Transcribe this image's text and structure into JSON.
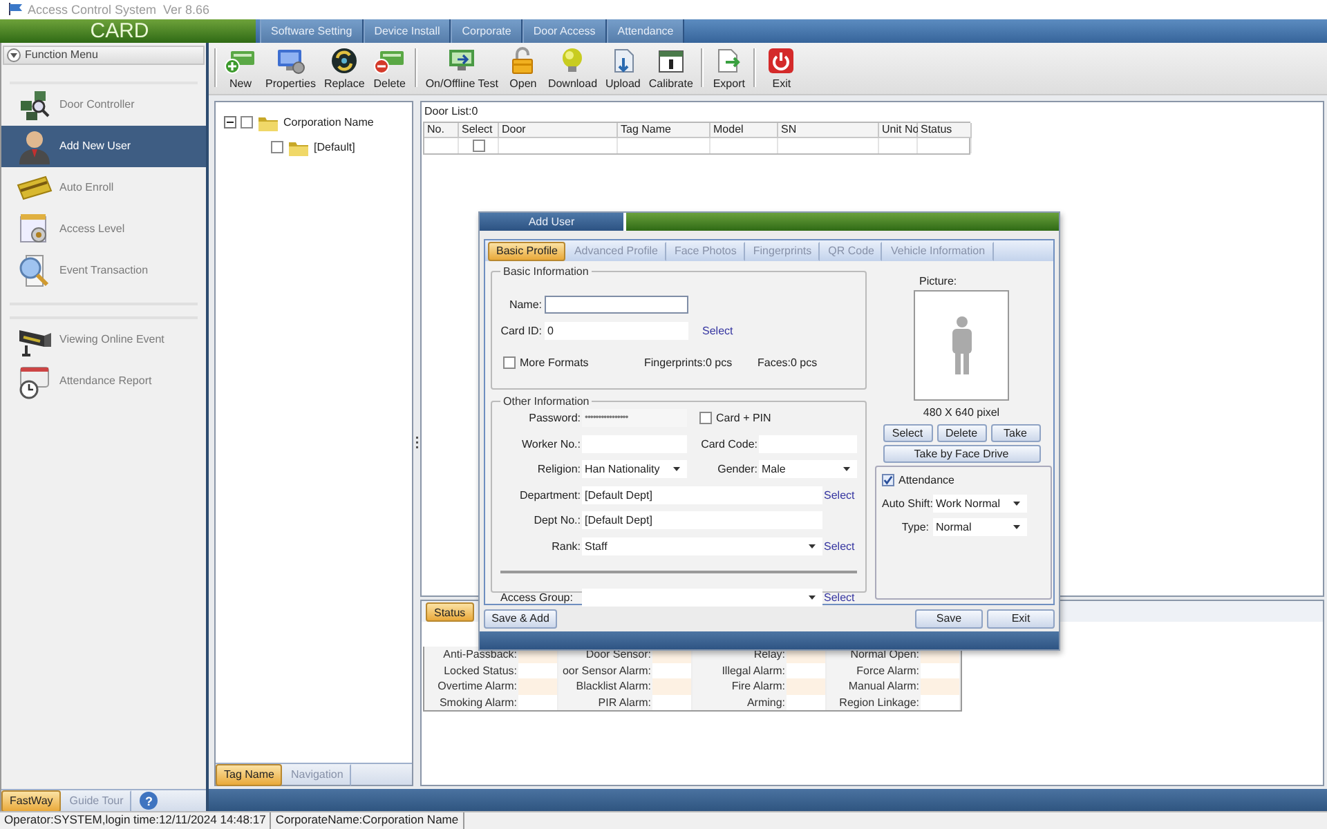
{
  "window": {
    "title": "Access Control System  Ver 8.66"
  },
  "header": {
    "logo": "CARD",
    "menu": [
      "Software Setting",
      "Device Install",
      "Corporate",
      "Door Access",
      "Attendance"
    ]
  },
  "sidebar": {
    "title": "Function Menu",
    "groups": [
      [
        {
          "label": "Door Controller",
          "selected": false
        },
        {
          "label": "Add New User",
          "selected": true
        },
        {
          "label": "Auto Enroll",
          "selected": false
        },
        {
          "label": "Access Level",
          "selected": false
        },
        {
          "label": "Event Transaction",
          "selected": false
        }
      ],
      [
        {
          "label": "Viewing Online Event",
          "selected": false
        },
        {
          "label": "Attendance Report",
          "selected": false
        }
      ]
    ],
    "tabs": [
      {
        "label": "FastWay",
        "selected": true
      },
      {
        "label": "Guide Tour",
        "selected": false
      }
    ],
    "help": "?"
  },
  "toolbar": [
    [
      "New",
      "Properties",
      "Replace",
      "Delete"
    ],
    [
      "On/Offline Test",
      "Open",
      "Download",
      "Upload",
      "Calibrate"
    ],
    [
      "Export"
    ],
    [
      "Exit"
    ]
  ],
  "tree": {
    "nodes": [
      {
        "label": "Corporation Name",
        "expanded": true,
        "checked": false,
        "children": [
          {
            "label": "[Default]",
            "checked": false
          }
        ]
      }
    ],
    "tabs": [
      {
        "label": "Tag Name",
        "selected": true
      },
      {
        "label": "Navigation",
        "selected": false
      }
    ]
  },
  "door_list": {
    "title": "Door List:0",
    "columns": [
      "No.",
      "Select",
      "Door",
      "Tag Name",
      "Model",
      "SN",
      "Unit No",
      "Status"
    ],
    "rows": [
      {
        "checked": false
      }
    ]
  },
  "status_panel": {
    "tabs": [
      {
        "label": "Status",
        "selected": true
      }
    ],
    "rows": [
      [
        "Anti-Passback:",
        "Door Sensor:",
        "Relay:",
        "Normal Open:"
      ],
      [
        "Locked Status:",
        "oor Sensor Alarm:",
        "Illegal Alarm:",
        "Force Alarm:"
      ],
      [
        "Overtime Alarm:",
        "Blacklist Alarm:",
        "Fire Alarm:",
        "Manual Alarm:"
      ],
      [
        "Smoking Alarm:",
        "PIR Alarm:",
        "Arming:",
        "Region Linkage:"
      ]
    ]
  },
  "dialog": {
    "title": "Add User",
    "tabs": [
      {
        "label": "Basic Profile",
        "selected": true
      },
      {
        "label": "Advanced Profile",
        "selected": false
      },
      {
        "label": "Face Photos",
        "selected": false
      },
      {
        "label": "Fingerprints",
        "selected": false
      },
      {
        "label": "QR Code",
        "selected": false
      },
      {
        "label": "Vehicle Information",
        "selected": false
      }
    ],
    "basic": {
      "title": "Basic Information",
      "name_label": "Name:",
      "card_id": {
        "label": "Card ID:",
        "value": "0",
        "link": "Select"
      },
      "more_formats": {
        "label": "More Formats",
        "checked": false
      },
      "fingerprints": "Fingerprints:0 pcs",
      "faces": "Faces:0 pcs"
    },
    "picture": {
      "label": "Picture:",
      "size": "480 X 640 pixel",
      "buttons": [
        "Select",
        "Delete",
        "Take"
      ],
      "wide_button": "Take by Face Drive"
    },
    "other": {
      "title": "Other Information",
      "password": {
        "label": "Password:",
        "value": "••••••••••••••••"
      },
      "card_pin": {
        "label": "Card + PIN",
        "checked": false
      },
      "worker_no": {
        "label": "Worker No.:"
      },
      "card_code": {
        "label": "Card Code:"
      },
      "religion": {
        "label": "Religion:",
        "value": "Han Nationality"
      },
      "gender": {
        "label": "Gender:",
        "value": "Male"
      },
      "department": {
        "label": "Department:",
        "value": "[Default Dept]",
        "link": "Select"
      },
      "dept_no": {
        "label": "Dept No.:",
        "value": "[Default Dept]"
      },
      "rank": {
        "label": "Rank:",
        "value": "Staff",
        "link": "Select"
      },
      "access_group": {
        "label": "Access Group:",
        "link": "Select"
      }
    },
    "attendance": {
      "label": "Attendance",
      "checked": true,
      "auto_shift": {
        "label": "Auto Shift:",
        "value": "Work Normal"
      },
      "type": {
        "label": "Type:",
        "value": "Normal"
      }
    },
    "buttons": {
      "save_add": "Save & Add",
      "save": "Save",
      "exit": "Exit"
    }
  },
  "status_bar": [
    "Operator:SYSTEM,login time:12/11/2024 14:48:17",
    "CorporateName:Corporation Name"
  ]
}
